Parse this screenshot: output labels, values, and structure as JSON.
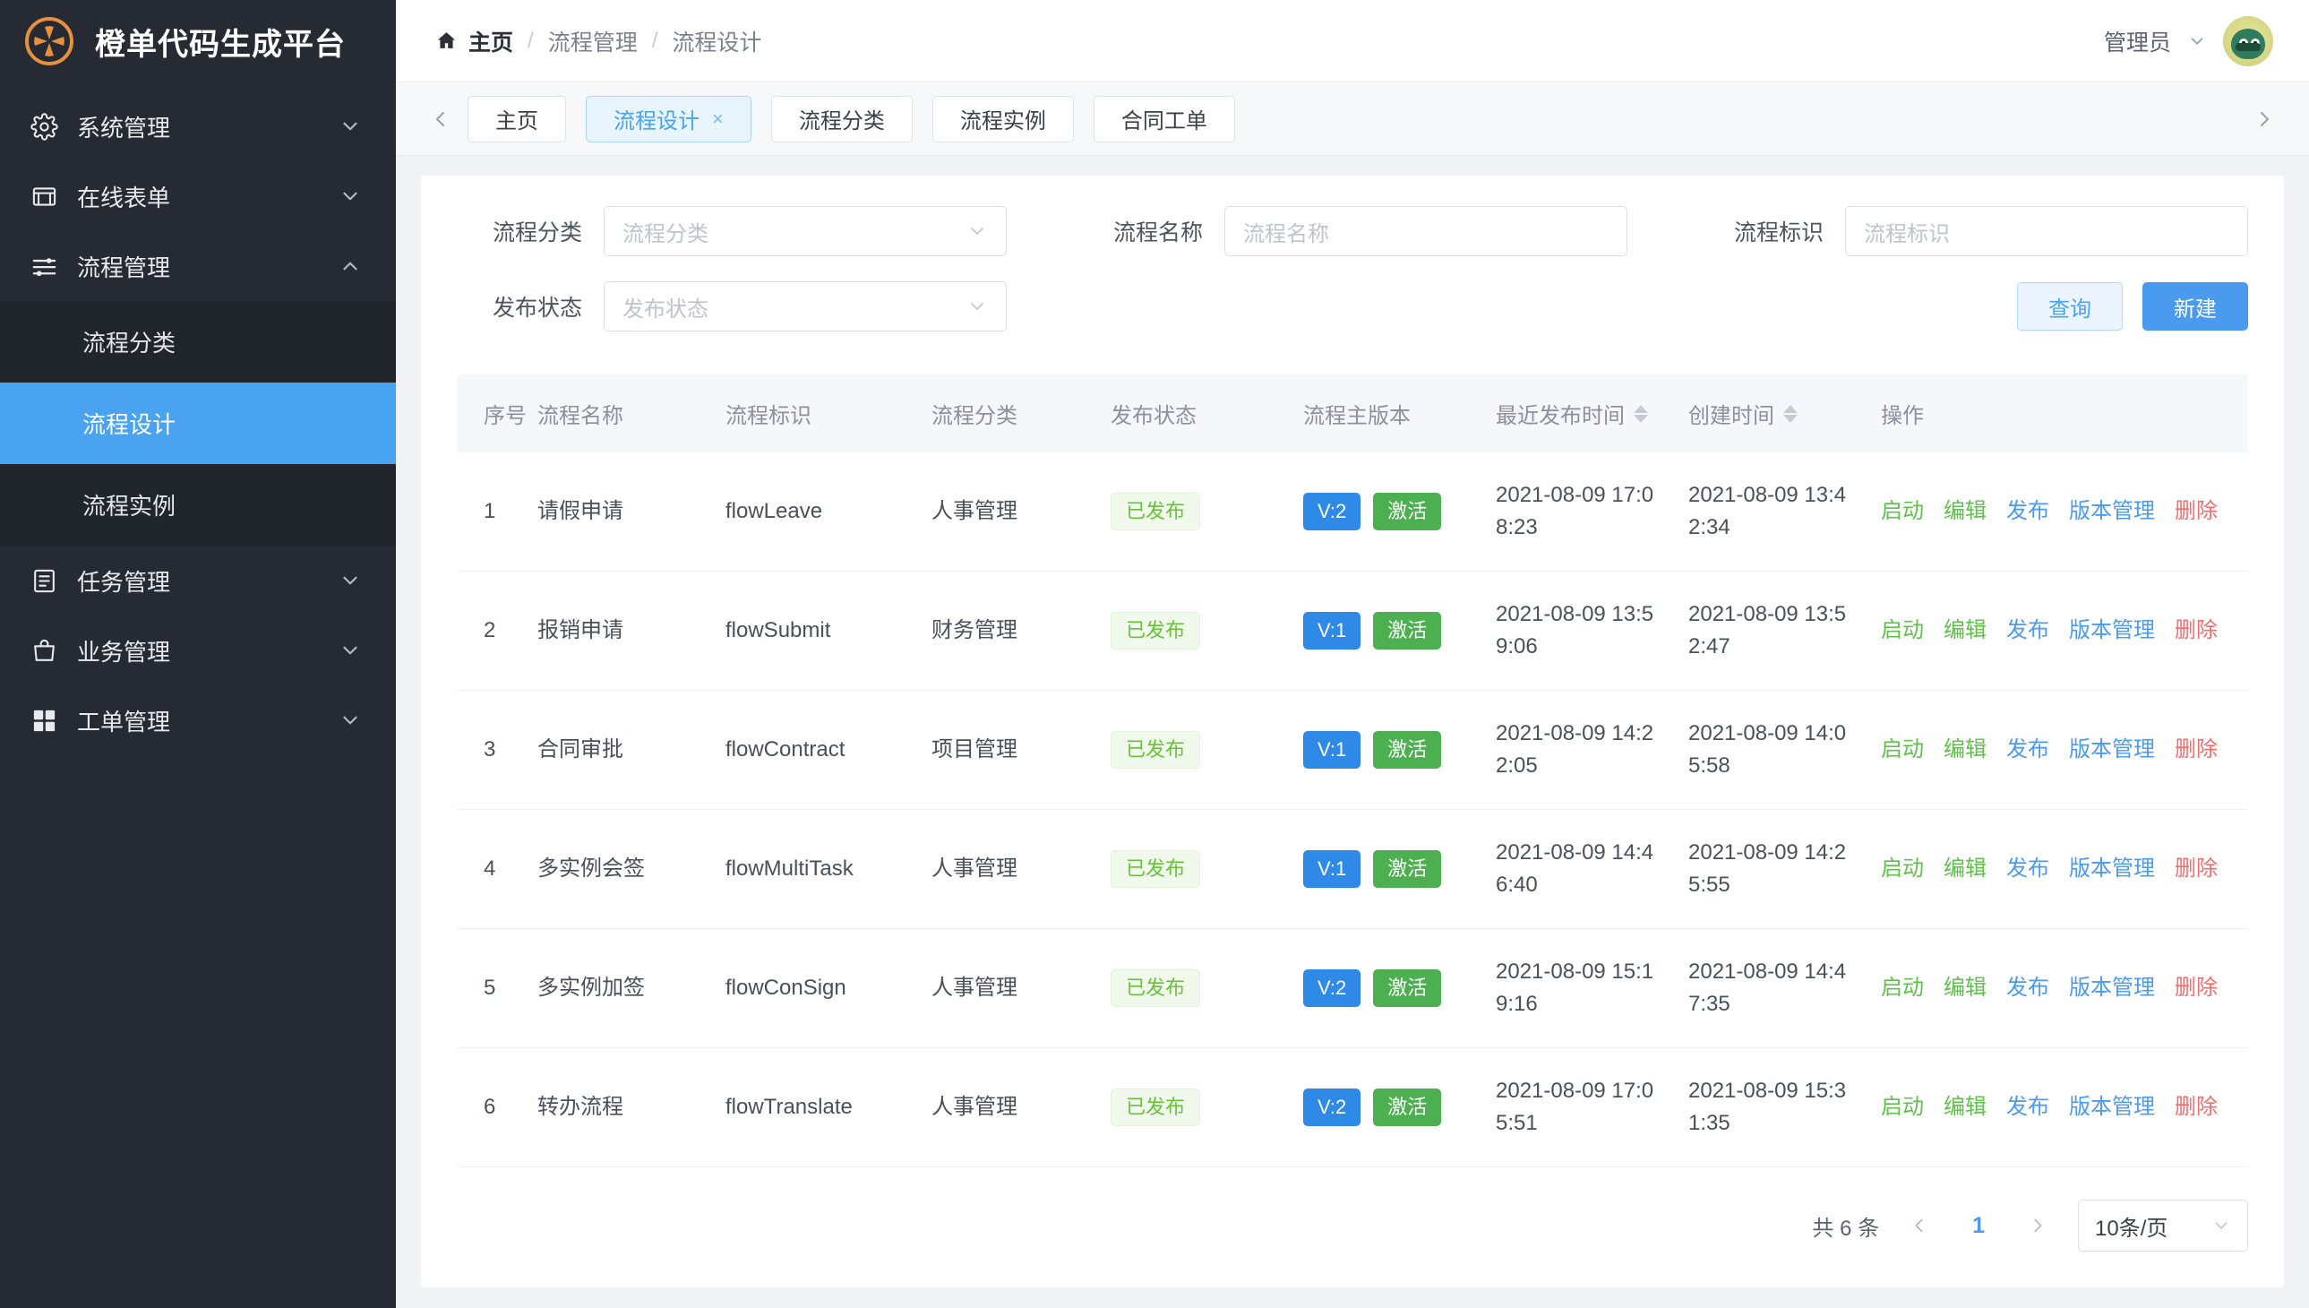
{
  "brand": {
    "title": "橙单代码生成平台",
    "logo_icon": "orange-slice-logo",
    "accent": "#e8903a"
  },
  "sidebar": {
    "items": [
      {
        "label": "系统管理",
        "icon": "gear-icon",
        "arrow": "chevron-down-icon"
      },
      {
        "label": "在线表单",
        "icon": "form-icon",
        "arrow": "chevron-down-icon"
      },
      {
        "label": "流程管理",
        "icon": "sliders-icon",
        "arrow": "chevron-up-icon",
        "expanded": true
      },
      {
        "label": "任务管理",
        "icon": "list-doc-icon",
        "arrow": "chevron-down-icon"
      },
      {
        "label": "业务管理",
        "icon": "briefcase-icon",
        "arrow": "chevron-down-icon"
      },
      {
        "label": "工单管理",
        "icon": "grid-icon",
        "arrow": "chevron-down-icon"
      }
    ],
    "submenu": [
      {
        "label": "流程分类",
        "active": false
      },
      {
        "label": "流程设计",
        "active": true
      },
      {
        "label": "流程实例",
        "active": false
      }
    ]
  },
  "topbar": {
    "home_label": "主页",
    "breadcrumbs": [
      "流程管理",
      "流程设计"
    ],
    "separator": "/",
    "user_name": "管理员"
  },
  "tabs": {
    "prev_icon": "chevron-left-icon",
    "next_icon": "chevron-right-icon",
    "items": [
      {
        "label": "主页",
        "active": false,
        "closable": false
      },
      {
        "label": "流程设计",
        "active": true,
        "closable": true,
        "close_glyph": "×"
      },
      {
        "label": "流程分类",
        "active": false,
        "closable": false
      },
      {
        "label": "流程实例",
        "active": false,
        "closable": false
      },
      {
        "label": "合同工单",
        "active": false,
        "closable": false
      }
    ]
  },
  "filters": {
    "category": {
      "label": "流程分类",
      "placeholder": "流程分类",
      "value": ""
    },
    "name": {
      "label": "流程名称",
      "placeholder": "流程名称",
      "value": ""
    },
    "key": {
      "label": "流程标识",
      "placeholder": "流程标识",
      "value": ""
    },
    "status": {
      "label": "发布状态",
      "placeholder": "发布状态",
      "value": ""
    },
    "search_button": "查询",
    "create_button": "新建"
  },
  "table": {
    "columns": [
      {
        "key": "idx",
        "label": "序号",
        "sortable": false
      },
      {
        "key": "name",
        "label": "流程名称",
        "sortable": false
      },
      {
        "key": "flow_key",
        "label": "流程标识",
        "sortable": false
      },
      {
        "key": "category",
        "label": "流程分类",
        "sortable": false
      },
      {
        "key": "status",
        "label": "发布状态",
        "sortable": false
      },
      {
        "key": "version",
        "label": "流程主版本",
        "sortable": false
      },
      {
        "key": "published_at",
        "label": "最近发布时间",
        "sortable": true
      },
      {
        "key": "created_at",
        "label": "创建时间",
        "sortable": true
      },
      {
        "key": "ops",
        "label": "操作",
        "sortable": false
      }
    ],
    "rows": [
      {
        "idx": "1",
        "name": "请假申请",
        "flow_key": "flowLeave",
        "category": "人事管理",
        "status": "已发布",
        "version": "V:2",
        "active_tag": "激活",
        "published_at": "2021-08-09 17:08:23",
        "created_at": "2021-08-09 13:42:34"
      },
      {
        "idx": "2",
        "name": "报销申请",
        "flow_key": "flowSubmit",
        "category": "财务管理",
        "status": "已发布",
        "version": "V:1",
        "active_tag": "激活",
        "published_at": "2021-08-09 13:59:06",
        "created_at": "2021-08-09 13:52:47"
      },
      {
        "idx": "3",
        "name": "合同审批",
        "flow_key": "flowContract",
        "category": "项目管理",
        "status": "已发布",
        "version": "V:1",
        "active_tag": "激活",
        "published_at": "2021-08-09 14:22:05",
        "created_at": "2021-08-09 14:05:58"
      },
      {
        "idx": "4",
        "name": "多实例会签",
        "flow_key": "flowMultiTask",
        "category": "人事管理",
        "status": "已发布",
        "version": "V:1",
        "active_tag": "激活",
        "published_at": "2021-08-09 14:46:40",
        "created_at": "2021-08-09 14:25:55"
      },
      {
        "idx": "5",
        "name": "多实例加签",
        "flow_key": "flowConSign",
        "category": "人事管理",
        "status": "已发布",
        "version": "V:2",
        "active_tag": "激活",
        "published_at": "2021-08-09 15:19:16",
        "created_at": "2021-08-09 14:47:35"
      },
      {
        "idx": "6",
        "name": "转办流程",
        "flow_key": "flowTranslate",
        "category": "人事管理",
        "status": "已发布",
        "version": "V:2",
        "active_tag": "激活",
        "published_at": "2021-08-09 17:05:51",
        "created_at": "2021-08-09 15:31:35"
      }
    ],
    "ops": [
      {
        "label": "启动",
        "color": "green"
      },
      {
        "label": "编辑",
        "color": "green"
      },
      {
        "label": "发布",
        "color": "blue"
      },
      {
        "label": "版本管理",
        "color": "blue"
      },
      {
        "label": "删除",
        "color": "red"
      }
    ]
  },
  "pagination": {
    "total_text": "共 6 条",
    "prev_icon": "chevron-left-icon",
    "next_icon": "chevron-right-icon",
    "current_page": "1",
    "page_size": "10条/页"
  },
  "colors": {
    "sidebar_bg": "#262b33",
    "submenu_bg": "#21252c",
    "active_blue": "#4aa3f0",
    "primary_blue": "#4a9bf0",
    "success_green": "#67c23a",
    "danger_red": "#f56c6c",
    "brand_orange": "#e8903a"
  }
}
